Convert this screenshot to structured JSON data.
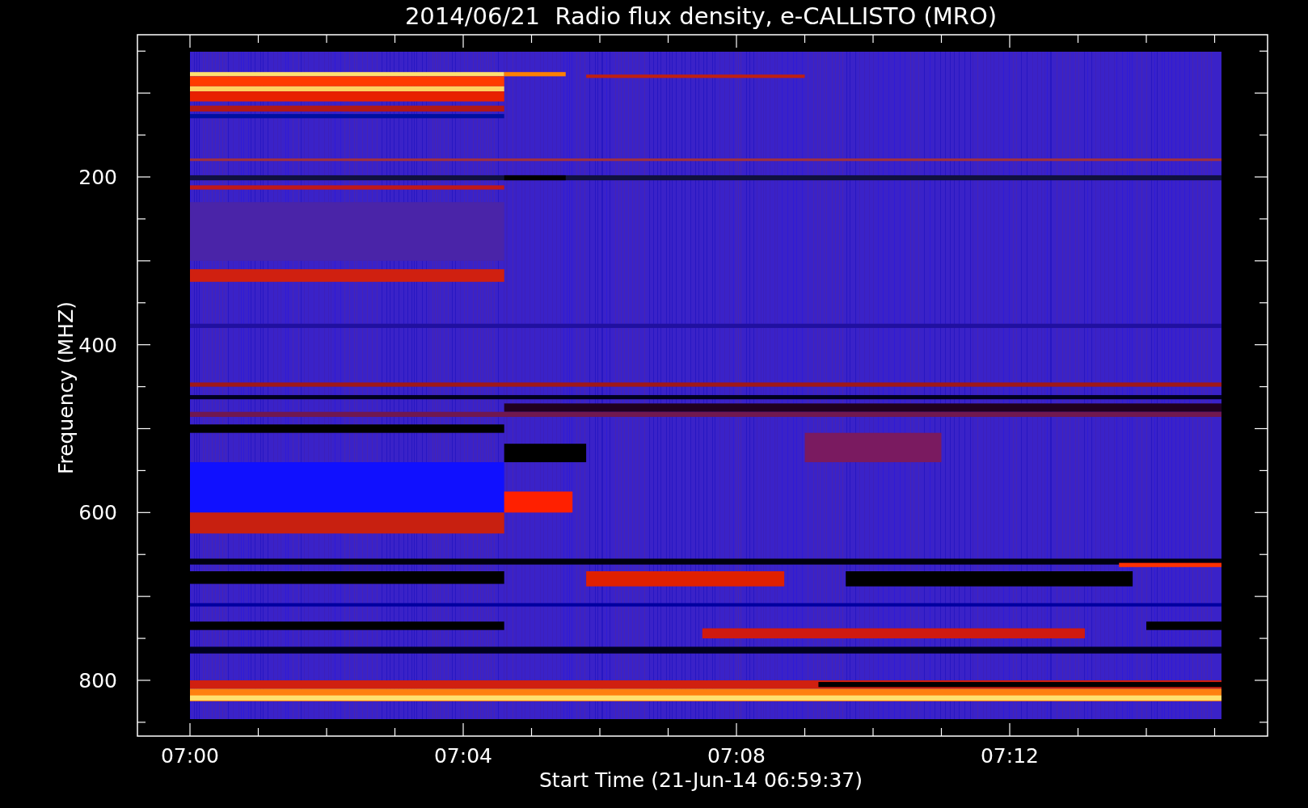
{
  "title": "2014/06/21  Radio flux density, e-CALLISTO (MRO)",
  "y_axis": {
    "label": "Frequency (MHZ)",
    "ticks": [
      "200",
      "400",
      "600",
      "800"
    ]
  },
  "x_axis": {
    "label": "Start Time (21-Jun-14 06:59:37)",
    "ticks": [
      "07:00",
      "07:04",
      "07:08",
      "07:12"
    ]
  }
}
